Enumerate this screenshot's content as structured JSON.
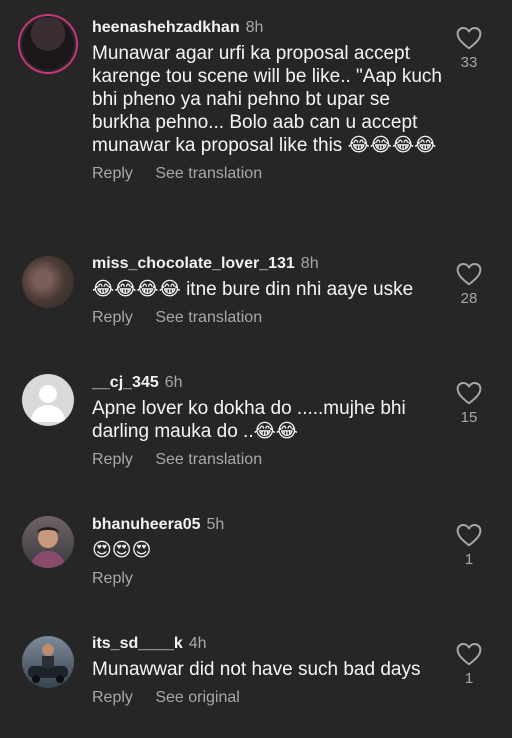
{
  "comments": [
    {
      "username": "heenashehzadkhan",
      "time": "8h",
      "text": "Munawar agar urfi ka proposal accept karenge tou scene will be like.. \"Aap kuch bhi pheno ya nahi pehno bt upar se burkha pehno... Bolo aab can u accept munawar ka proposal like this 😂😂😂😂",
      "reply": "Reply",
      "translate": "See translation",
      "likes": "33"
    },
    {
      "username": "miss_chocolate_lover_131",
      "time": "8h",
      "text": "😂😂😂😂 itne bure din nhi aaye uske",
      "reply": "Reply",
      "translate": "See translation",
      "likes": "28"
    },
    {
      "username": "__cj_345",
      "time": "6h",
      "text": "Apne lover ko dokha do .....mujhe bhi darling mauka do ..😂😂",
      "reply": "Reply",
      "translate": "See translation",
      "likes": "15"
    },
    {
      "username": "bhanuheera05",
      "time": "5h",
      "text": "😍😍😍",
      "reply": "Reply",
      "likes": "1"
    },
    {
      "username": "its_sd____k",
      "time": "4h",
      "text": "Munawwar did not have such bad days",
      "reply": "Reply",
      "translate": "See original",
      "likes": "1"
    }
  ]
}
